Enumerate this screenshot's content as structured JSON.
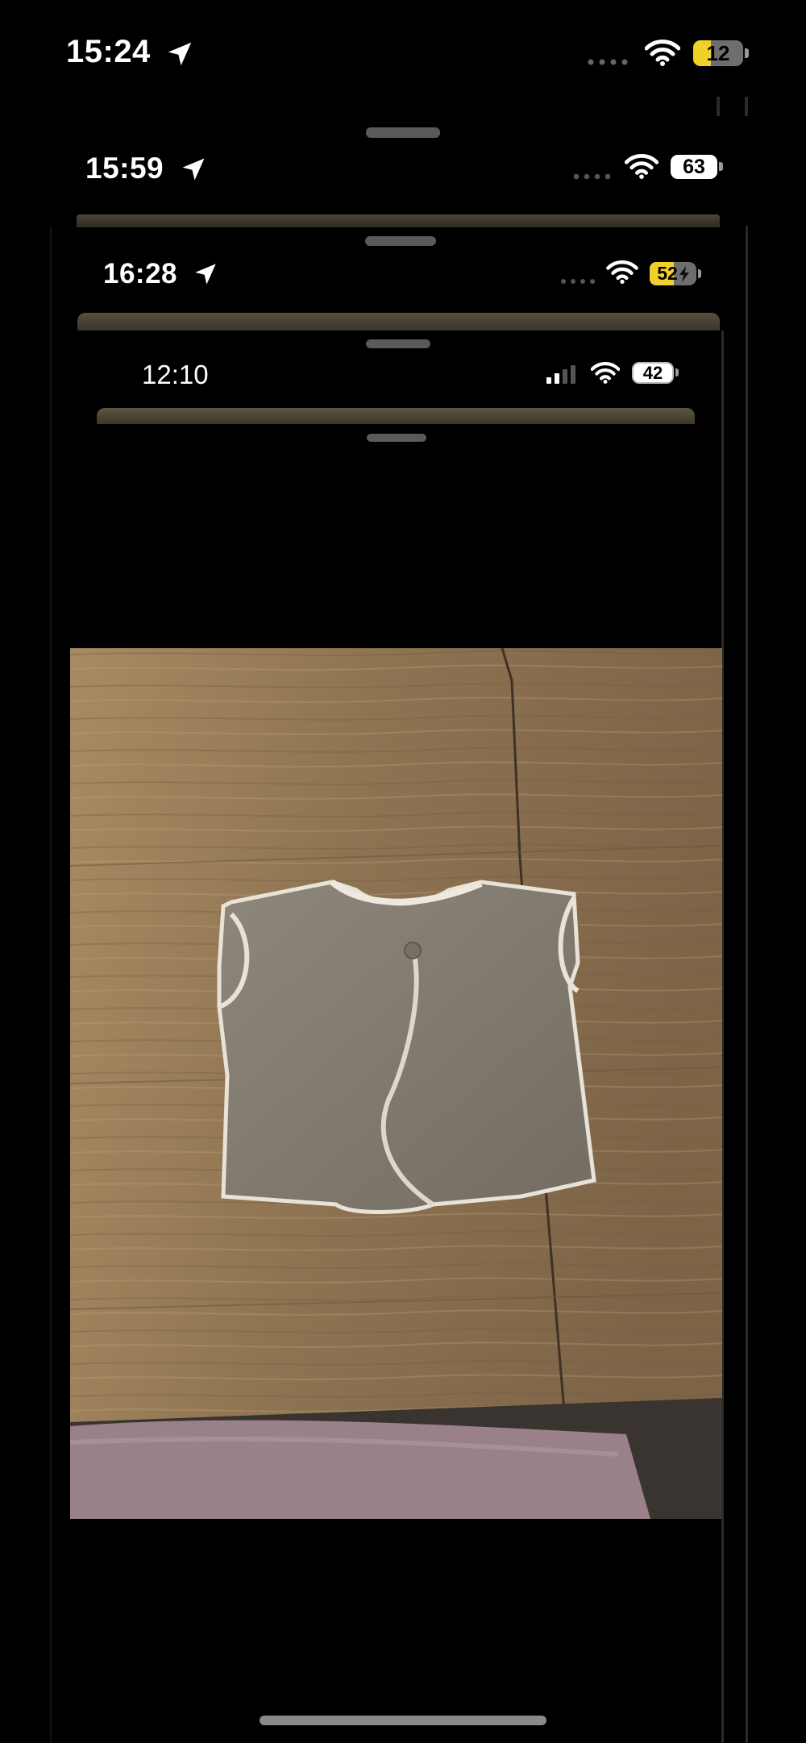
{
  "screens": [
    {
      "time": "15:24",
      "battery": "12",
      "battery_color": "#f2d02a",
      "signal": "no-service-dots",
      "location_arrow": true
    },
    {
      "time": "15:59",
      "battery": "63",
      "battery_color": "#ffffff",
      "signal": "no-service-dots",
      "location_arrow": true
    },
    {
      "time": "16:28",
      "battery": "52",
      "battery_color": "#f2d02a",
      "charging": true,
      "signal": "no-service-dots",
      "location_arrow": true
    },
    {
      "time": "12:10",
      "battery": "42",
      "battery_color": "#ffffff",
      "signal": "cellular-bars",
      "location_arrow": false
    }
  ],
  "photo": {
    "subject": "vest-photo",
    "icon": "image"
  },
  "home_indicator": "home-indicator"
}
